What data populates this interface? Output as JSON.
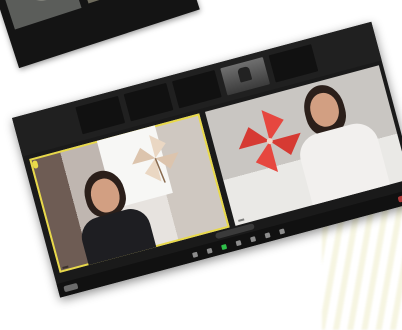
{
  "gallery": {
    "participants": [
      {
        "label": "",
        "caption": ""
      },
      {
        "label": "",
        "caption": ""
      },
      {
        "label": "",
        "caption": ""
      },
      {
        "label": "",
        "caption": ""
      },
      {
        "label": "",
        "caption": ""
      }
    ]
  },
  "tiles": {
    "left_name": "",
    "right_name": ""
  },
  "colors": {
    "window_bg": "#1a1a1a",
    "active_speaker": "#e8d94a",
    "pinwheel_red": "#e6473f",
    "pinwheel_beige": "#ead7c3",
    "join_green": "#2fbf4a"
  },
  "icons": [
    "microphone-icon",
    "camera-icon",
    "security-icon",
    "participants-icon",
    "chat-icon",
    "share-screen-icon",
    "record-icon",
    "reactions-icon",
    "end-call-icon"
  ]
}
